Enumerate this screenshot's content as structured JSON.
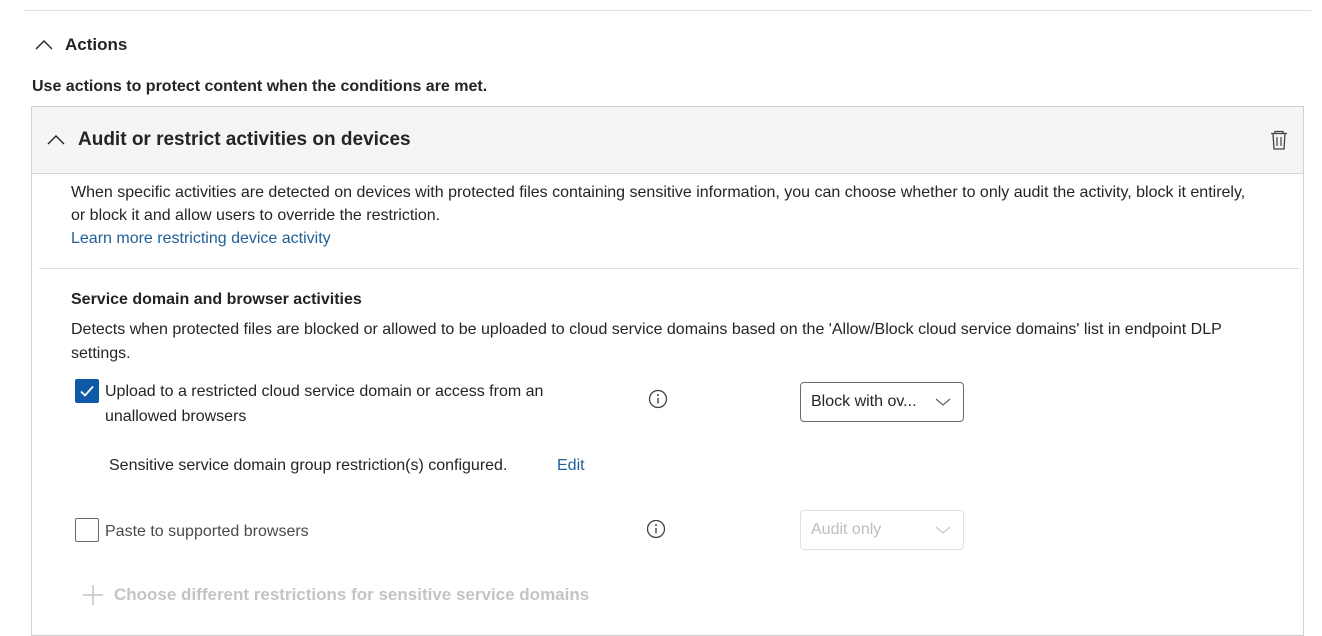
{
  "actions": {
    "title": "Actions",
    "intro": "Use actions to protect content when the conditions are met."
  },
  "panel": {
    "title": "Audit or restrict activities on devices",
    "description": "When specific activities are detected on devices with protected files containing sensitive information, you can choose whether to only audit the activity, block it entirely, or block it and allow users to override the restriction.",
    "learn_more_link": "Learn more restricting device activity"
  },
  "section": {
    "title": "Service domain and browser activities",
    "description": "Detects when protected files are blocked or allowed to be uploaded to cloud service domains based on the 'Allow/Block cloud service domains' list in endpoint DLP settings."
  },
  "rows": [
    {
      "label": "Upload to a restricted cloud service domain or access from an unallowed browsers",
      "checked": true,
      "dropdown_value": "Block with ov...",
      "dropdown_enabled": true
    },
    {
      "label": "Paste to supported browsers",
      "checked": false,
      "dropdown_value": "Audit only",
      "dropdown_enabled": false
    }
  ],
  "configured": {
    "text": "Sensitive service domain group restriction(s) configured.",
    "edit_link": "Edit"
  },
  "choose_button": {
    "label": "Choose different restrictions for sensitive service domains"
  },
  "icons": {
    "collapse": "chevron-up-icon",
    "delete": "trash-icon",
    "info": "info-icon",
    "dropdown": "chevron-down-icon",
    "check": "checkmark-icon",
    "add": "plus-icon"
  },
  "colors": {
    "accent": "#0f5aa8",
    "link": "#1f5f99",
    "header_bg": "#f5f5f5",
    "disabled_text": "#c4c4c4"
  }
}
